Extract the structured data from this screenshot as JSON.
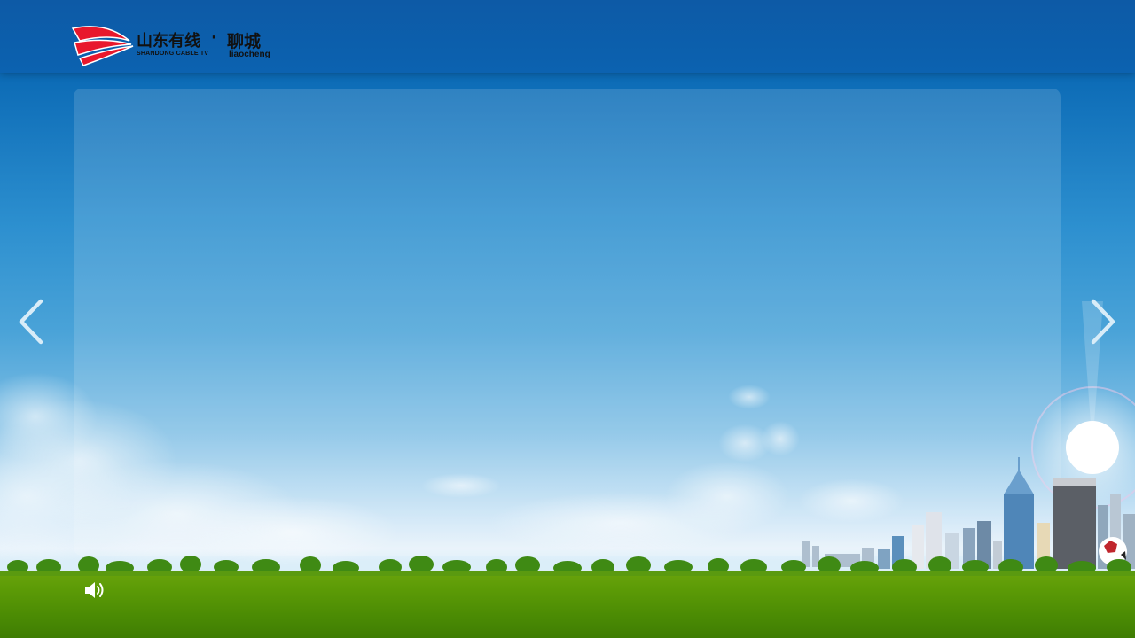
{
  "header": {
    "logo": {
      "brand_cn": "山东有线",
      "separator": "·",
      "city_cn": "聊城",
      "brand_en": "SHANDONG CABLE TV",
      "city_en": "liaocheng",
      "colors": {
        "red": "#e8182c",
        "text": "#111111"
      }
    }
  },
  "navigation": {
    "prev_icon": "chevron-left-icon",
    "next_icon": "chevron-right-icon"
  },
  "footer": {
    "volume_icon": "speaker-volume-icon"
  },
  "theme": {
    "header_bg": "#0c62b0",
    "sky_top": "#0c6bb6",
    "sky_bottom": "#e7f2fb",
    "ground": "#5b9a06"
  }
}
